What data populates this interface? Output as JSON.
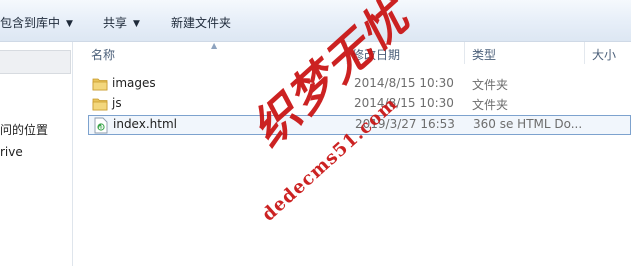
{
  "toolbar": {
    "include_in_library": "包含到库中",
    "share": "共享",
    "new_folder": "新建文件夹"
  },
  "nav": {
    "recent_places_partial": "问的位置",
    "drive_partial": "rive"
  },
  "columns": {
    "name": "名称",
    "date_modified": "修改日期",
    "type": "类型",
    "size": "大小"
  },
  "files": [
    {
      "name": "images",
      "date": "2014/8/15 10:30",
      "type": "文件夹",
      "icon": "folder-icon"
    },
    {
      "name": "js",
      "date": "2014/8/15 10:30",
      "type": "文件夹",
      "icon": "folder-icon"
    },
    {
      "name": "index.html",
      "date": "2019/3/27 16:53",
      "type": "360 se HTML Do...",
      "icon": "html-file-icon",
      "selected": true
    }
  ],
  "watermark": {
    "chinese": "织梦无忧",
    "url": "dedecms51.com"
  },
  "colors": {
    "toolbar_bg": "#e6eef8",
    "selection_border": "#7da2ce",
    "watermark": "#c80f0f",
    "folder": "#e8c35a"
  }
}
